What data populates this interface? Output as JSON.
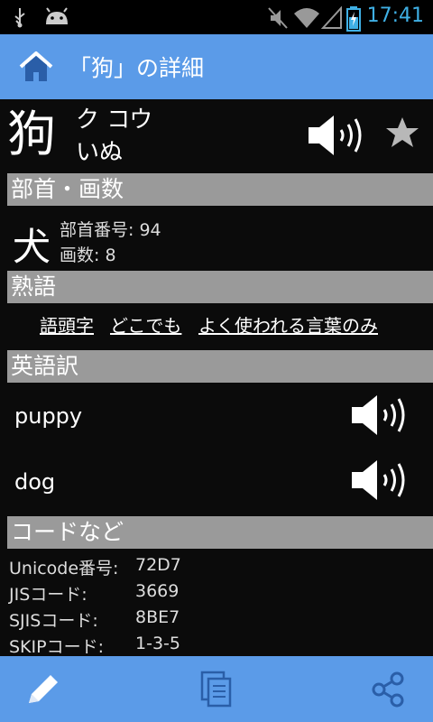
{
  "status_bar": {
    "time": "17:41",
    "icons": [
      "usb-icon",
      "android-icon",
      "mute-icon",
      "wifi-icon",
      "signal-icon",
      "battery-charging-icon"
    ]
  },
  "action_bar": {
    "title": "「狗」の詳細",
    "home_icon": "home-icon"
  },
  "kanji": {
    "character": "狗",
    "on_reading": "ク コウ",
    "kun_reading": "いぬ"
  },
  "sections": {
    "radical": "部首・画数",
    "compounds": "熟語",
    "english": "英語訳",
    "codes": "コードなど"
  },
  "radical": {
    "character": "犬",
    "number_line": "部首番号: 94",
    "strokes_line": "画数: 8"
  },
  "compound_links": [
    "語頭字",
    "どこでも",
    "よく使われる言葉のみ"
  ],
  "english_words": [
    "puppy",
    "dog"
  ],
  "codes": [
    {
      "label": "Unicode番号:",
      "value": "72D7"
    },
    {
      "label": "JISコード:",
      "value": "3669"
    },
    {
      "label": "SJISコード:",
      "value": "8BE7"
    },
    {
      "label": "SKIPコード:",
      "value": "1-3-5"
    }
  ],
  "bottom_bar": [
    "edit-icon",
    "copy-icon",
    "share-icon"
  ],
  "colors": {
    "accent": "#5b9be8",
    "section_bg": "#9a9a9a",
    "background": "#0b0b0b",
    "clock": "#3fb0e5"
  }
}
